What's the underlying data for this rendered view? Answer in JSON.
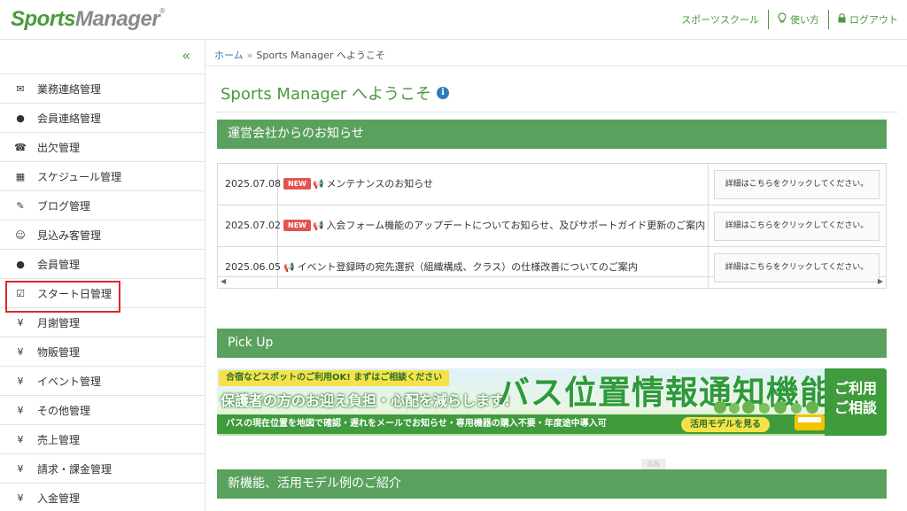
{
  "header": {
    "logo_part1": "Sports",
    "logo_part2": "Manager",
    "logo_reg": "®",
    "nav": [
      {
        "label": "スポーツスクール",
        "icon": ""
      },
      {
        "label": "使い方",
        "icon": "lightbulb-icon"
      },
      {
        "label": "ログアウト",
        "icon": "lock-icon"
      }
    ]
  },
  "sidebar": {
    "collapse_glyph": "«",
    "items": [
      {
        "label": "業務連絡管理",
        "icon": "envelope-icon",
        "glyph": "✉"
      },
      {
        "label": "会員連絡管理",
        "icon": "comment-icon",
        "glyph": "💬"
      },
      {
        "label": "出欠管理",
        "icon": "phone-icon",
        "glyph": "☎"
      },
      {
        "label": "スケジュール管理",
        "icon": "calendar-icon",
        "glyph": "▦"
      },
      {
        "label": "ブログ管理",
        "icon": "pencil-icon",
        "glyph": "✎"
      },
      {
        "label": "見込み客管理",
        "icon": "smile-icon",
        "glyph": "☺"
      },
      {
        "label": "会員管理",
        "icon": "user-icon",
        "glyph": "●"
      },
      {
        "label": "スタート日管理",
        "icon": "check-square-icon",
        "glyph": "☑"
      },
      {
        "label": "月謝管理",
        "icon": "yen-icon",
        "glyph": "¥"
      },
      {
        "label": "物販管理",
        "icon": "yen-icon",
        "glyph": "¥"
      },
      {
        "label": "イベント管理",
        "icon": "yen-icon",
        "glyph": "¥"
      },
      {
        "label": "その他管理",
        "icon": "yen-icon",
        "glyph": "¥"
      },
      {
        "label": "売上管理",
        "icon": "yen-icon",
        "glyph": "¥"
      },
      {
        "label": "請求・課金管理",
        "icon": "yen-icon",
        "glyph": "¥"
      },
      {
        "label": "入金管理",
        "icon": "yen-icon",
        "glyph": "¥"
      }
    ]
  },
  "breadcrumb": {
    "home": "ホーム",
    "separator": "»",
    "current": "Sports Manager へようこそ"
  },
  "page_title": "Sports Manager へようこそ",
  "sections": {
    "news_title": "運営会社からのお知らせ",
    "pickup_title": "Pick Up",
    "features_title": "新機能、活用モデル例のご紹介"
  },
  "news": [
    {
      "date": "2025.07.08",
      "badge": "NEW",
      "text": "メンテナンスのお知らせ",
      "detail": "詳細はこちらをクリックしてください。"
    },
    {
      "date": "2025.07.02",
      "badge": "NEW",
      "text": "入会フォーム機能のアップデートについてお知らせ、及びサポートガイド更新のご案内",
      "detail": "詳細はこちらをクリックしてください。"
    },
    {
      "date": "2025.06.05",
      "badge": "",
      "text": "イベント登録時の宛先選択（組織構成、クラス）の仕様改善についてのご案内",
      "detail": "詳細はこちらをクリックしてください。"
    }
  ],
  "banner": {
    "tag": "合宿などスポットのご利用OK! まずはご相談ください",
    "sub": "保護者の方のお迎え負担・心配を減らします!",
    "big": "バス位置情報通知機能",
    "bottom": "バスの現在位置を地図で確認・遅れをメールでお知らせ・専用機器の購入不要・年度途中導入可",
    "cta": "活用モデルを見る",
    "consult_line1": "ご利用",
    "consult_line2": "ご相談"
  },
  "misc": {
    "small_box": "広告"
  },
  "colors": {
    "brand_green": "#4a9a3b",
    "section_green": "#5ba15e",
    "link_blue": "#2f7bbf",
    "new_badge": "#e05552",
    "highlight_red": "#e0262b"
  }
}
